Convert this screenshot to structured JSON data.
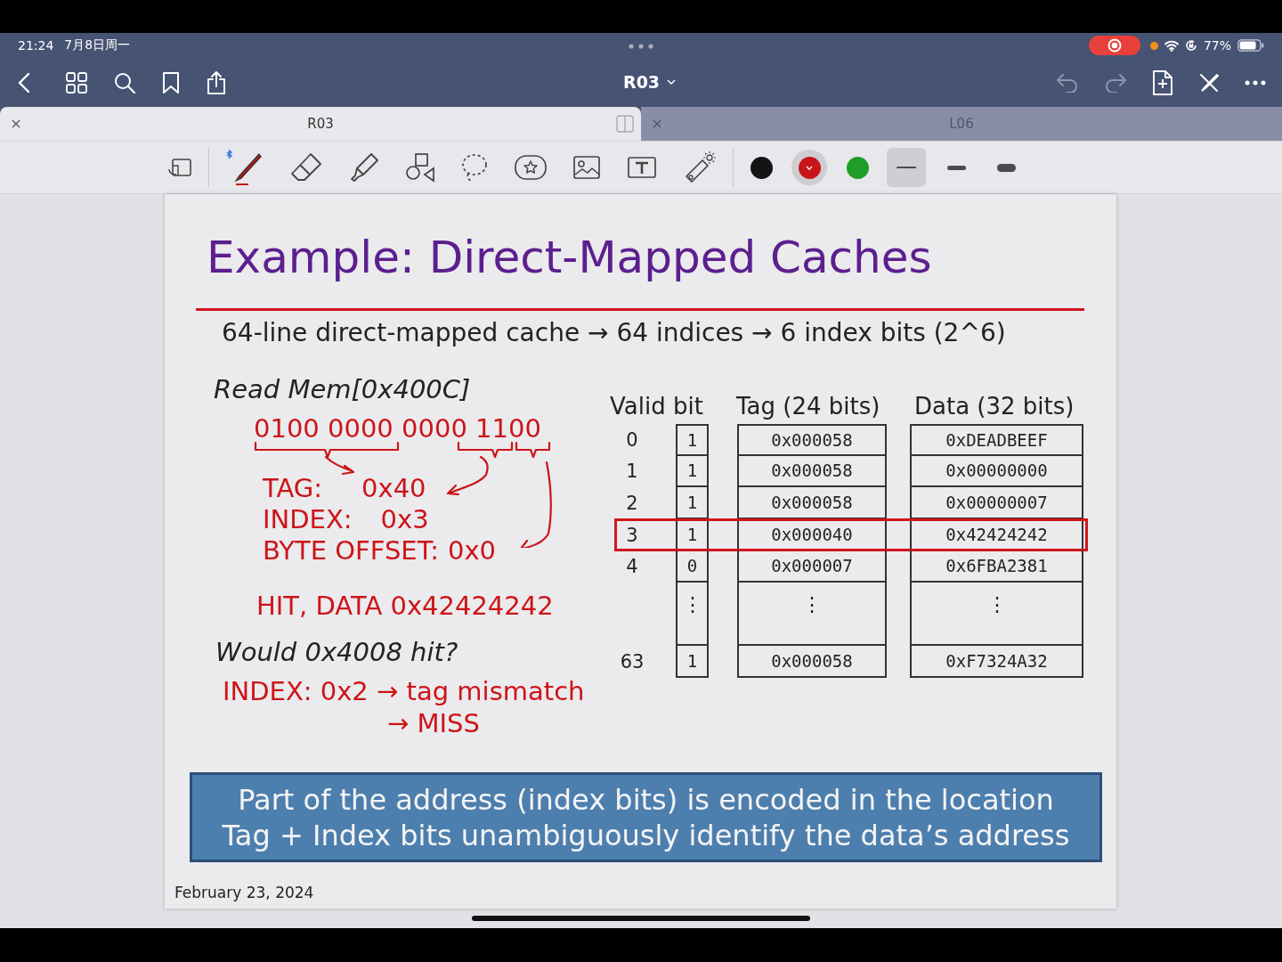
{
  "status_bar": {
    "time": "21:24",
    "date": "7月8日周一",
    "battery": "77%"
  },
  "nav": {
    "title": "R03"
  },
  "tabs": [
    {
      "label": "R03",
      "selected": true
    },
    {
      "label": "L06",
      "selected": false
    }
  ],
  "toolbar": {
    "colors": [
      {
        "color": "#141414",
        "selected": false
      },
      {
        "color": "#c8141a",
        "selected": true
      },
      {
        "color": "#1e9e28",
        "selected": false
      }
    ],
    "widths": [
      {
        "kind": "thin",
        "selected": true
      },
      {
        "kind": "medium",
        "selected": false
      },
      {
        "kind": "thick",
        "selected": false
      }
    ]
  },
  "slide": {
    "title": "Example: Direct-Mapped Caches",
    "subtitle": "64-line direct-mapped cache → 64 indices → 6 index bits (2^6)",
    "read_label": "Read Mem[0x400C]",
    "binary": "0100 0000 0000 1100",
    "fields": [
      {
        "label": "TAG:",
        "value": "0x40"
      },
      {
        "label": "INDEX:",
        "value": "0x3"
      },
      {
        "label": "BYTE OFFSET:",
        "value": "0x0"
      }
    ],
    "result": "HIT, DATA 0x42424242",
    "question": "Would 0x4008 hit?",
    "answer": [
      "INDEX: 0x2 → tag mismatch",
      "→ MISS"
    ],
    "headers": [
      "Valid bit",
      "Tag (24 bits)",
      "Data (32 bits)"
    ],
    "rows": [
      {
        "kind": "entry",
        "index": "0",
        "valid": "1",
        "tag": "0x000058",
        "data": "0xDEADBEEF",
        "selected": false
      },
      {
        "kind": "entry",
        "index": "1",
        "valid": "1",
        "tag": "0x000058",
        "data": "0x00000000",
        "selected": false
      },
      {
        "kind": "entry",
        "index": "2",
        "valid": "1",
        "tag": "0x000058",
        "data": "0x00000007",
        "selected": false
      },
      {
        "kind": "entry",
        "index": "3",
        "valid": "1",
        "tag": "0x000040",
        "data": "0x42424242",
        "selected": true
      },
      {
        "kind": "entry",
        "index": "4",
        "valid": "0",
        "tag": "0x000007",
        "data": "0x6FBA2381",
        "selected": false
      },
      {
        "kind": "ellipsis",
        "valid": "⋮",
        "tag": "⋮",
        "data": "⋮",
        "selected": false
      },
      {
        "kind": "entry",
        "index": "63",
        "valid": "1",
        "tag": "0x000058",
        "data": "0xF7324A32",
        "selected": false
      }
    ],
    "callout": [
      "Part of the address (index bits) is encoded in the location",
      "Tag + Index bits unambiguously identify the data’s address"
    ],
    "date": "February 23, 2024"
  }
}
